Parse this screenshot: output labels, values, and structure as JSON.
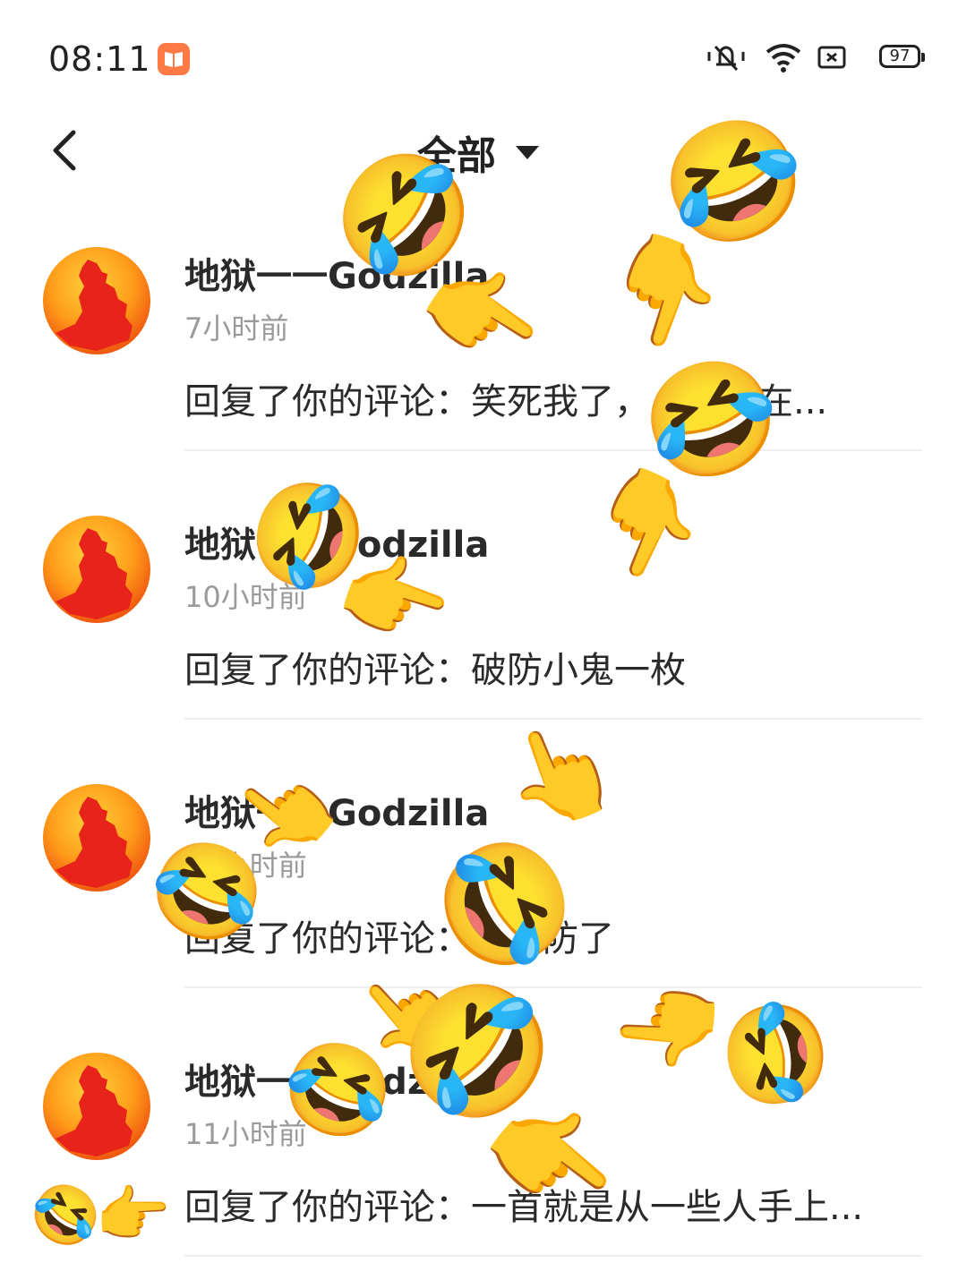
{
  "status_bar": {
    "time": "08:11",
    "battery": "97",
    "icons": [
      "notes-app-icon",
      "mute-icon",
      "wifi-icon",
      "sim-icon",
      "battery-icon"
    ]
  },
  "header": {
    "back_icon": "chevron-left-icon",
    "filter_label": "全部",
    "filter_icon": "caret-down-icon"
  },
  "notifications": [
    {
      "name": "地狱一一Godzilla",
      "time_ago": "7小时前",
      "message": "回复了你的评论：笑死我了，…就是在..."
    },
    {
      "name": "地狱一一Godzilla",
      "time_ago": "10小时前",
      "message": "回复了你的评论：破防小鬼一枚"
    },
    {
      "name": "地狱一一Godzilla",
      "time_ago": "11小时前",
      "message": "回复了你的评论：…破防了"
    },
    {
      "name": "地狱一一Godzilla",
      "time_ago": "11小时前",
      "message": "回复了你的评论：一首就是从一些人手上..."
    }
  ],
  "overlay_emojis": {
    "laugh": "🤣",
    "point": "👉"
  },
  "colors": {
    "accent_orange": "#ff7a45",
    "avatar_red": "#e8231a",
    "secondary_text": "#9a9a9a"
  }
}
